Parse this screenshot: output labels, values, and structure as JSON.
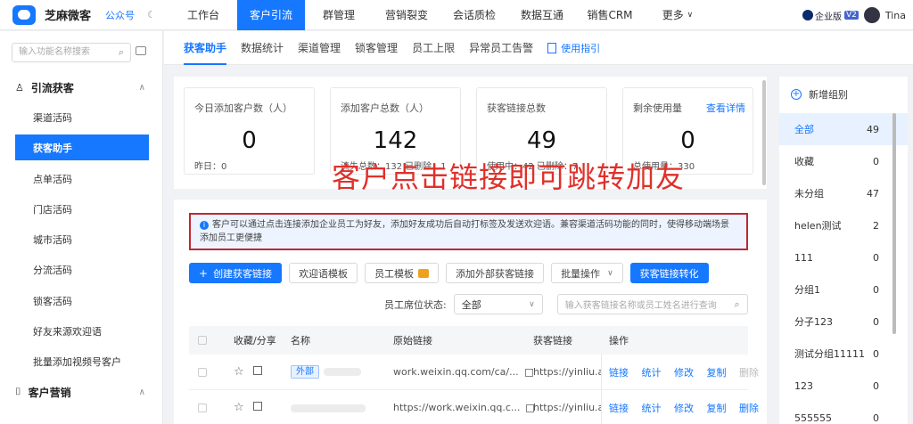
{
  "topbar": {
    "app_name": "芝麻微客",
    "account_type": "公众号",
    "nav": [
      "工作台",
      "客户引流",
      "群管理",
      "营销裂变",
      "会话质检",
      "数据互通",
      "销售CRM",
      "更多"
    ],
    "active_nav": "客户引流",
    "enterprise_label": "企业版",
    "version": "V2",
    "user": "Tina"
  },
  "sidebar": {
    "search_placeholder": "输入功能名称搜索",
    "section1": "引流获客",
    "items": [
      "渠道活码",
      "获客助手",
      "点单活码",
      "门店活码",
      "城市活码",
      "分流活码",
      "锁客活码",
      "好友来源欢迎语",
      "批量添加视频号客户"
    ],
    "active_item": "获客助手",
    "section2": "客户营销"
  },
  "subtabs": {
    "items": [
      "获客助手",
      "数据统计",
      "渠道管理",
      "锁客管理",
      "员工上限",
      "异常员工告警"
    ],
    "guide": "使用指引"
  },
  "stats": [
    {
      "label": "今日添加客户数（人）",
      "value": "0",
      "foot": "昨日：0"
    },
    {
      "label": "添加客户总数（人）",
      "value": "142",
      "foot": "流失总数：132    已删除：1"
    },
    {
      "label": "获客链接总数",
      "value": "49",
      "foot": "使用中：42    已删除：7"
    },
    {
      "label": "剩余使用量",
      "value": "0",
      "link": "查看详情",
      "foot": "总使用量：330"
    }
  ],
  "overlay_text": "客户点击链接即可跳转加友",
  "notice": "客户可以通过点击连接添加企业员工为好友，添加好友成功后自动打标签及发送欢迎语。兼容渠道活码功能的同时，使得移动端场景添加员工更便捷",
  "toolbar": {
    "create": "创建获客链接",
    "welcome": "欢迎语模板",
    "staff_template": "员工模板",
    "external": "添加外部获客链接",
    "batch": "批量操作",
    "convert": "获客链接转化"
  },
  "filter": {
    "label": "员工席位状态:",
    "value": "全部",
    "search_placeholder": "输入获客链接名称或员工姓名进行查询"
  },
  "table": {
    "headers": [
      "收藏/分享",
      "名称",
      "原始链接",
      "获客链接",
      "操作"
    ],
    "rows": [
      {
        "tag": "外部",
        "orig": "work.weixin.qq.com/ca/...",
        "link": "https://yinliu.app",
        "ops": [
          "链接",
          "统计",
          "修改",
          "复制",
          "删除"
        ]
      },
      {
        "tag": "",
        "orig": "https://work.weixin.qq.c...",
        "link": "https://yinliu.app",
        "ops": [
          "链接",
          "统计",
          "修改",
          "复制",
          "删除"
        ]
      }
    ]
  },
  "groups": {
    "add_label": "新增组别",
    "items": [
      {
        "name": "全部",
        "count": "49"
      },
      {
        "name": "收藏",
        "count": "0"
      },
      {
        "name": "未分组",
        "count": "47"
      },
      {
        "name": "helen测试",
        "count": "2"
      },
      {
        "name": "111",
        "count": "0"
      },
      {
        "name": "分组1",
        "count": "0"
      },
      {
        "name": "分子123",
        "count": "0"
      },
      {
        "name": "测试分组11111",
        "count": "0"
      },
      {
        "name": "123",
        "count": "0"
      },
      {
        "name": "555555",
        "count": "0"
      }
    ]
  }
}
